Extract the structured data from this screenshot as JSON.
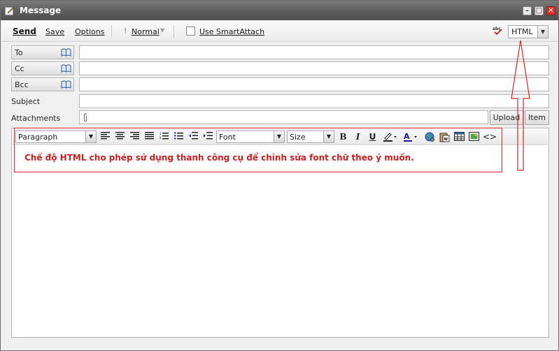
{
  "window": {
    "title": "Message"
  },
  "toolbar": {
    "send": "Send",
    "save": "Save",
    "options": "Options",
    "priority": "Normal",
    "smartattach": "Use SmartAttach",
    "format_value": "HTML"
  },
  "fields": {
    "to": "To",
    "cc": "Cc",
    "bcc": "Bcc",
    "subject": "Subject",
    "attachments": "Attachments",
    "upload": "Upload",
    "item": "Item"
  },
  "editor_toolbar": {
    "paragraph": "Paragraph",
    "font": "Font",
    "size": "Size"
  },
  "annotation": {
    "text": "Chế độ HTML cho phép sử dụng thanh công cụ để chỉnh sửa font chữ theo ý muốn.",
    "color": "#d4262a"
  },
  "colors": {
    "accent_red": "#d4262a",
    "title_bar": "#5c5c5c"
  }
}
